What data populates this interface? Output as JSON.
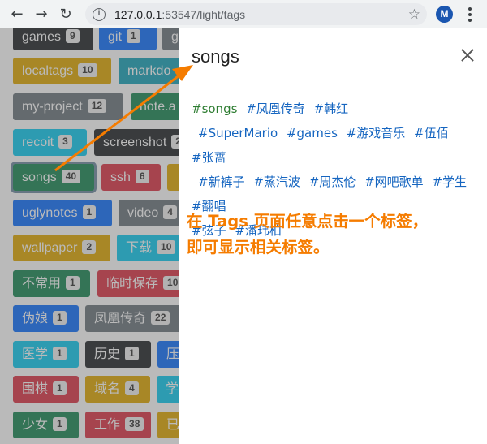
{
  "browser": {
    "url_host": "127.0.0.1",
    "url_rest": ":53547/light/tags",
    "avatar_letter": "M",
    "back_icon": "back-arrow-icon",
    "forward_icon": "forward-arrow-icon",
    "reload_icon": "reload-icon"
  },
  "tags": [
    {
      "label": "games",
      "count": "9",
      "color": "#212529"
    },
    {
      "label": "git",
      "count": "1",
      "color": "#0d6efd"
    },
    {
      "label": "g",
      "count": "",
      "color": "#6c757d"
    },
    {
      "label": "localtags",
      "count": "10",
      "color": "#e0a800"
    },
    {
      "label": "markdo",
      "count": "",
      "color": "#17a2b8"
    },
    {
      "label": "my-project",
      "count": "12",
      "color": "#6c757d"
    },
    {
      "label": "note.a",
      "count": "",
      "color": "#198754"
    },
    {
      "label": "recoit",
      "count": "3",
      "color": "#0dcaf0"
    },
    {
      "label": "screenshot",
      "count": "2",
      "color": "#212529"
    },
    {
      "label": "songs",
      "count": "40",
      "color": "#198754"
    },
    {
      "label": "ssh",
      "count": "6",
      "color": "#dc3545"
    },
    {
      "label": "",
      "count": "",
      "color": "#e0a800"
    },
    {
      "label": "uglynotes",
      "count": "1",
      "color": "#0d6efd"
    },
    {
      "label": "video",
      "count": "4",
      "color": "#6c757d"
    },
    {
      "label": "wallpaper",
      "count": "2",
      "color": "#e0a800"
    },
    {
      "label": "下载",
      "count": "10",
      "color": "#0dcaf0"
    },
    {
      "label": "不常用",
      "count": "1",
      "color": "#198754"
    },
    {
      "label": "临时保存",
      "count": "10",
      "color": "#dc3545"
    },
    {
      "label": "伪娘",
      "count": "1",
      "color": "#0d6efd"
    },
    {
      "label": "凤凰传奇",
      "count": "22",
      "color": "#6c757d"
    },
    {
      "label": "医学",
      "count": "1",
      "color": "#0dcaf0"
    },
    {
      "label": "历史",
      "count": "1",
      "color": "#212529"
    },
    {
      "label": "压",
      "count": "",
      "color": "#0d6efd"
    },
    {
      "label": "围棋",
      "count": "1",
      "color": "#dc3545"
    },
    {
      "label": "域名",
      "count": "4",
      "color": "#e0a800"
    },
    {
      "label": "学",
      "count": "",
      "color": "#0dcaf0"
    },
    {
      "label": "少女",
      "count": "1",
      "color": "#198754"
    },
    {
      "label": "工作",
      "count": "38",
      "color": "#dc3545"
    },
    {
      "label": "已",
      "count": "",
      "color": "#e0a800"
    }
  ],
  "drawer": {
    "title": "songs",
    "related_tags": [
      "#songs",
      "#凤凰传奇",
      "#韩红",
      "#SuperMario",
      "#games",
      "#游戏音乐",
      "#伍佰",
      "#张蔷",
      "#新裤子",
      "#蒸汽波",
      "#周杰伦",
      "#网吧歌单",
      "#学生",
      "#翻唱",
      "#弦子",
      "#潘玮柏"
    ],
    "note_line1": "在 Tags 页面任意点击一个标签，",
    "note_line2": "即可显示相关标签。"
  },
  "colors": {
    "tag_link": "#1565c0",
    "current_tag": "#2e7d32",
    "annotation": "#f57c00"
  }
}
